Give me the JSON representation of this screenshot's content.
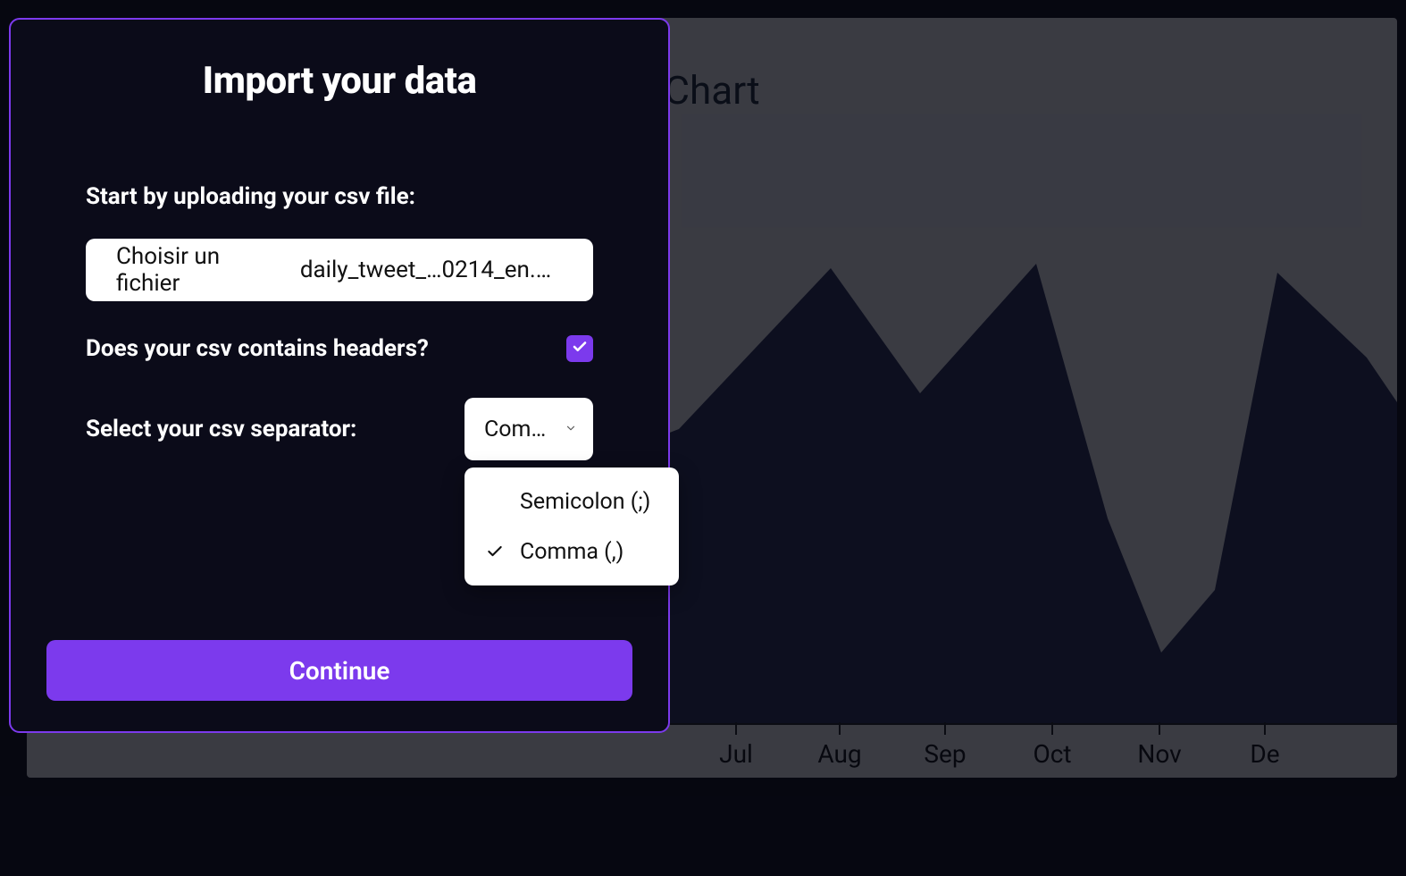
{
  "modal": {
    "title": "Import your data",
    "uploadLabel": "Start by uploading your csv file:",
    "fileButton": "Choisir un fichier",
    "fileName": "daily_tweet_…0214_en.csv",
    "headersLabel": "Does your csv contains headers?",
    "headersChecked": true,
    "separatorLabel": "Select your csv separator:",
    "separatorSelected": "Com…",
    "separatorOptions": [
      "Semicolon (;)",
      "Comma (,)"
    ],
    "continue": "Continue"
  },
  "chart_data": {
    "type": "area",
    "title": "Chart",
    "categories": [
      "Jul",
      "Aug",
      "Sep",
      "Oct",
      "Nov",
      "De"
    ],
    "values": [
      45,
      72,
      58,
      73,
      10,
      70
    ],
    "ylim": [
      0,
      100
    ],
    "xlabel": "",
    "ylabel": ""
  },
  "colors": {
    "accent": "#7c3aed",
    "modalBg": "#0b0b19",
    "areaFill": "#2a3159"
  }
}
